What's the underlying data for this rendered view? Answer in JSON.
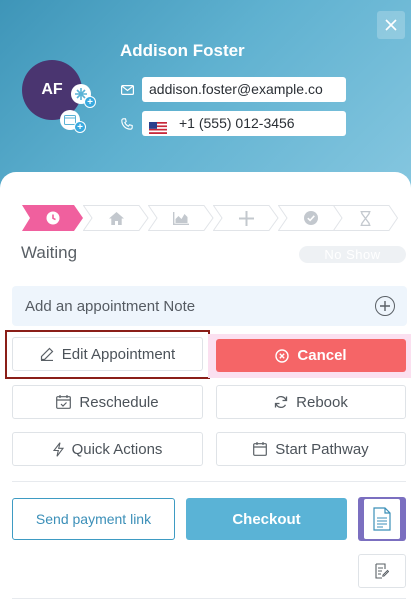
{
  "patient": {
    "initials": "AF",
    "name": "Addison Foster",
    "email": "addison.foster@example.co",
    "phone": "+1 (555) 012-3456"
  },
  "header_icons": {
    "close": "close-icon",
    "email": "envelope-icon",
    "phone": "phone-icon",
    "flag": "us-flag-icon"
  },
  "stepper": {
    "steps": [
      {
        "icon": "clock-icon",
        "active": true
      },
      {
        "icon": "home-icon",
        "active": false
      },
      {
        "icon": "chart-icon",
        "active": false
      },
      {
        "icon": "plus-icon",
        "active": false
      },
      {
        "icon": "check-circle-icon",
        "active": false
      },
      {
        "icon": "hourglass-icon",
        "active": false
      }
    ]
  },
  "status": {
    "label": "Waiting",
    "no_show_label": "No Show"
  },
  "note": {
    "placeholder": "Add an appointment Note"
  },
  "actions": {
    "edit": "Edit Appointment",
    "cancel": "Cancel",
    "reschedule": "Reschedule",
    "rebook": "Rebook",
    "quick_actions": "Quick Actions",
    "start_pathway": "Start Pathway"
  },
  "footer": {
    "payment_link": "Send payment link",
    "checkout": "Checkout"
  },
  "colors": {
    "header_gradient_start": "#3e95b8",
    "header_gradient_end": "#86c7e0",
    "avatar_bg": "#4a3570",
    "active_step": "#f0609e",
    "cancel_bg": "#f56567",
    "checkout_bg": "#5ab3d6",
    "doc_button_bg": "#7b6fc0",
    "highlight_outline": "#8a1e18"
  }
}
